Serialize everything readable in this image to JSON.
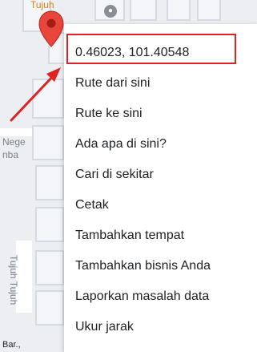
{
  "map": {
    "labels": {
      "top_orange": "Tujuh",
      "side_1": "Nege",
      "side_2": "nba",
      "vertical": "Tujuh Tujuh",
      "bottom": "Bar.,"
    }
  },
  "context_menu": {
    "coordinates": "0.46023, 101.40548",
    "items": [
      "Rute dari sini",
      "Rute ke sini",
      "Ada apa di sini?",
      "Cari di sekitar",
      "Cetak",
      "Tambahkan tempat",
      "Tambahkan bisnis Anda",
      "Laporkan masalah data",
      "Ukur jarak"
    ]
  },
  "colors": {
    "highlight_box": "#e02222",
    "marker": "#e8453c",
    "arrow": "#e02222"
  },
  "icons": {
    "marker": "map-pin-icon",
    "arrow": "annotation-arrow-icon"
  }
}
